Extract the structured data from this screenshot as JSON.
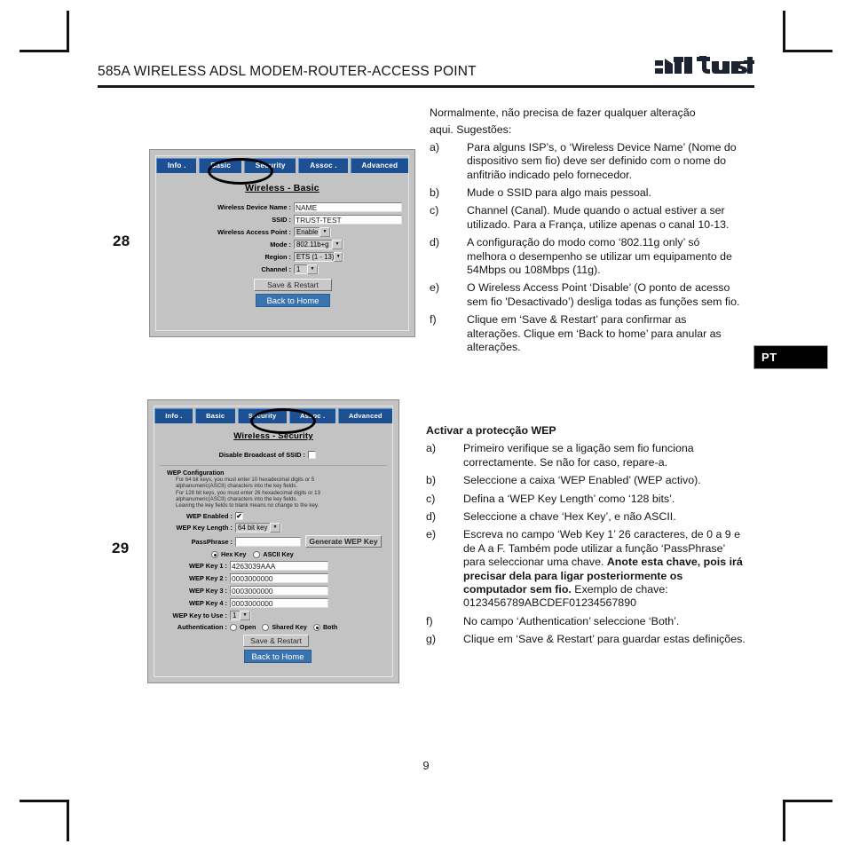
{
  "document": {
    "header_title": "585A WIRELESS ADSL MODEM-ROUTER-ACCESS POINT",
    "brand": "Trust",
    "footer_page_number": "9",
    "language_badge": "PT",
    "margin_numbers": {
      "first": "28",
      "second": "29"
    },
    "accent_blue": "#1d4f93",
    "button_blue": "#3a74b0",
    "panel_gray": "#c3c3c3"
  },
  "screenshot_basic": {
    "tabs": [
      {
        "label": "Info ."
      },
      {
        "label": "Basic"
      },
      {
        "label": "Security"
      },
      {
        "label": "Assoc ."
      },
      {
        "label": "Advanced"
      }
    ],
    "highlighted_tab": "Basic",
    "panel_title": "Wireless - Basic",
    "fields": {
      "device_name_label": "Wireless Device Name :",
      "device_name_value": "NAME",
      "ssid_label": "SSID :",
      "ssid_value": "TRUST-TEST",
      "ap_label": "Wireless Access Point :",
      "ap_value": "Enable",
      "mode_label": "Mode :",
      "mode_value": "802.11b+g",
      "region_label": "Region :",
      "region_value": "ETS (1 - 13)",
      "channel_label": "Channel :",
      "channel_value": "1"
    },
    "buttons": {
      "save": "Save & Restart",
      "back": "Back to Home"
    }
  },
  "screenshot_security": {
    "tabs": [
      {
        "label": "Info ."
      },
      {
        "label": "Basic"
      },
      {
        "label": "Security"
      },
      {
        "label": "Assoc ."
      },
      {
        "label": "Advanced"
      }
    ],
    "highlighted_tab": "Security",
    "panel_title": "Wireless - Security",
    "disable_broadcast_label": "Disable Broadcast of SSID :",
    "wep_config_heading": "WEP Configuration",
    "wep_notes": [
      "For 64 bit keys, you must enter 10 hexadecimal digits or 5",
      "alphanumeric(ASCII) characters into the key fields.",
      "For 128 bit keys, you must enter 26 hexadecimal digits or 13",
      "alphanumeric(ASCII) characters into the key fields.",
      "Leaving the key fields to blank means no change to the key."
    ],
    "fields": {
      "wep_enabled_label": "WEP Enabled :",
      "key_length_label": "WEP Key Length :",
      "key_length_value": "64 bit key",
      "passphrase_label": "PassPhrase :",
      "passphrase_value": "",
      "generate_button": "Generate WEP Key",
      "hex_key_label": "Hex Key",
      "ascii_key_label": "ASCII Key",
      "key1_label": "WEP Key 1 :",
      "key1_value": "4263039AAA",
      "key2_label": "WEP Key 2 :",
      "key2_value": "0003000000",
      "key3_label": "WEP Key 3 :",
      "key3_value": "0003000000",
      "key4_label": "WEP Key 4 :",
      "key4_value": "0003000000",
      "key_to_use_label": "WEP Key to Use :",
      "key_to_use_value": "1",
      "authentication_label": "Authentication :",
      "auth_open_label": "Open",
      "auth_shared_label": "Shared Key",
      "auth_both_label": "Both"
    },
    "buttons": {
      "save": "Save & Restart",
      "back": "Back to Home"
    }
  },
  "instructions_basic": {
    "lead_line1": "Normalmente, não precisa de fazer qualquer alteração",
    "lead_line2": "aqui. Sugestões:",
    "items": [
      {
        "marker": "a)",
        "text": "Para alguns ISP’s, o ‘Wireless Device Name’ (Nome do dispositivo sem fio) deve ser definido com o nome do anfitrião indicado pelo fornecedor."
      },
      {
        "marker": "b)",
        "text": "Mude o SSID para algo mais pessoal."
      },
      {
        "marker": "c)",
        "text": "Channel (Canal). Mude quando o actual estiver a ser utilizado. Para a França, utilize apenas o canal 10-13."
      },
      {
        "marker": "d)",
        "text": "A configuração do modo como ‘802.11g only’ só melhora o desempenho se utilizar um equipamento de 54Mbps ou 108Mbps (11g)."
      },
      {
        "marker": "e)",
        "text": "O Wireless Access Point ‘Disable’  (O ponto de acesso sem fio 'Desactivado’) desliga todas as funções sem fio."
      },
      {
        "marker": "f)",
        "text": "Clique em ‘Save & Restart’ para confirmar as alterações. Clique em ‘Back to home’ para anular as alterações."
      }
    ]
  },
  "instructions_security": {
    "title": "Activar a protecção WEP",
    "items": [
      {
        "marker": "a)",
        "text": "Primeiro verifique se a ligação sem fio funciona correctamente. Se não for caso, repare-a."
      },
      {
        "marker": "b)",
        "text": "Seleccione a caixa ‘WEP Enabled’ (WEP activo)."
      },
      {
        "marker": "c)",
        "text": "Defina a ‘WEP Key Length’ como ‘128 bits’."
      },
      {
        "marker": "d)",
        "text": "Seleccione a chave ‘Hex Key’, e não ASCII."
      },
      {
        "marker": "e)",
        "text_before": "Escreva no campo ‘Web Key 1’ 26 caracteres, de 0 a 9 e de A a F. Também pode utilizar a função ‘PassPhrase’ para seleccionar uma chave. ",
        "text_bold": "Anote esta chave, pois irá precisar dela para ligar posteriormente os computador sem fio.",
        "text_after": " Exemplo de chave: 0123456789ABCDEF01234567890"
      },
      {
        "marker": "f)",
        "text": "No campo ‘Authentication’ seleccione ‘Both’."
      },
      {
        "marker": "g)",
        "text": "Clique em ‘Save & Restart’ para guardar estas definições."
      }
    ]
  }
}
